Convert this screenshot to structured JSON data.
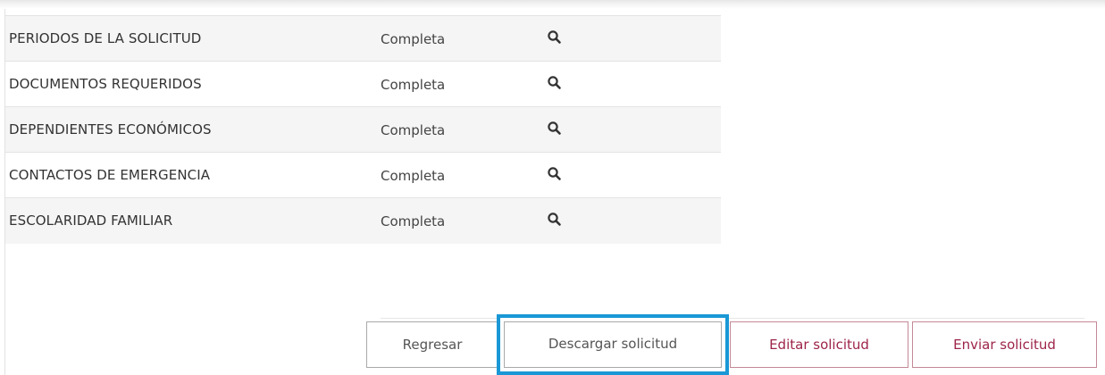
{
  "table": {
    "rows": [
      {
        "name": "PERIODOS DE LA SOLICITUD",
        "status": "Completa",
        "icon": "search-icon"
      },
      {
        "name": "DOCUMENTOS REQUERIDOS",
        "status": "Completa",
        "icon": "search-icon"
      },
      {
        "name": "DEPENDIENTES ECONÓMICOS",
        "status": "Completa",
        "icon": "search-icon"
      },
      {
        "name": "CONTACTOS DE EMERGENCIA",
        "status": "Completa",
        "icon": "search-icon"
      },
      {
        "name": "ESCOLARIDAD FAMILIAR",
        "status": "Completa",
        "icon": "search-icon"
      }
    ]
  },
  "actions": {
    "regresar_label": "Regresar",
    "descargar_label": "Descargar solicitud",
    "editar_label": "Editar solicitud",
    "enviar_label": "Enviar solicitud"
  },
  "colors": {
    "brand": "#9d2449",
    "highlight": "#1a98d5",
    "text": "#333333"
  }
}
